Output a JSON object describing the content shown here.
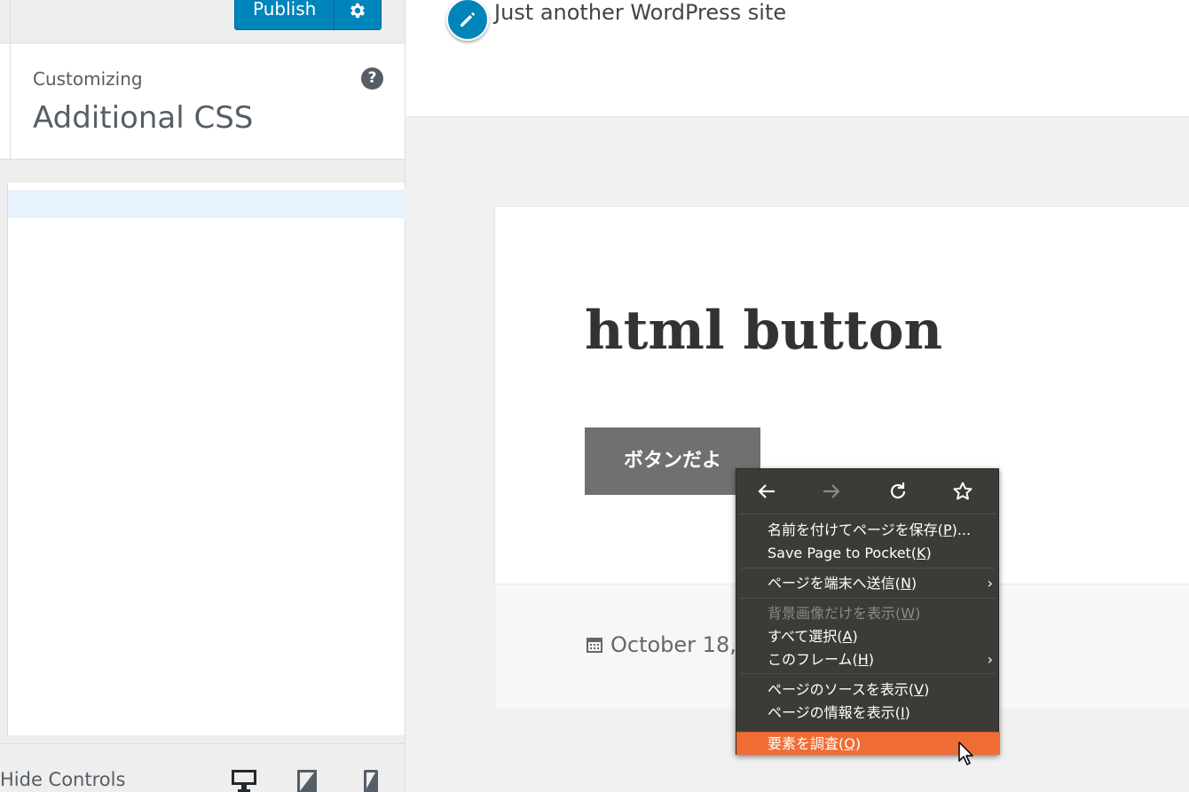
{
  "sidebar": {
    "publish_label": "Publish",
    "customizing_label": "Customizing",
    "section_title": "Additional CSS",
    "help_icon": "help-circle-icon",
    "footer": {
      "hide_controls_label": "Hide Controls",
      "devices": [
        "desktop-icon",
        "tablet-icon",
        "mobile-icon"
      ]
    }
  },
  "preview": {
    "site_tagline": "Just another WordPress site",
    "post_title": "html button",
    "button_label": "ボタンだよ",
    "post_date": "October 18,"
  },
  "context_menu": {
    "nav": [
      "back-icon",
      "forward-icon",
      "reload-icon",
      "bookmark-icon"
    ],
    "items": [
      {
        "pre": "名前を付けてページを保存(",
        "key": "P",
        "post": ")..."
      },
      {
        "pre": "Save Page to Pocket(",
        "key": "K",
        "post": ")"
      },
      {
        "pre": "ページを端末へ送信(",
        "key": "N",
        "post": ")"
      },
      {
        "pre": "背景画像だけを表示(",
        "key": "W",
        "post": ")"
      },
      {
        "pre": "すべて選択(",
        "key": "A",
        "post": ")"
      },
      {
        "pre": "このフレーム(",
        "key": "H",
        "post": ")"
      },
      {
        "pre": "ページのソースを表示(",
        "key": "V",
        "post": ")"
      },
      {
        "pre": "ページの情報を表示(",
        "key": "I",
        "post": ")"
      },
      {
        "pre": "要素を調査(",
        "key": "Q",
        "post": ")"
      }
    ],
    "submenu_arrow": "›"
  },
  "colors": {
    "publish_blue": "#0085ba",
    "menu_bg": "#3c3b37",
    "menu_highlight": "#ef6c35"
  }
}
